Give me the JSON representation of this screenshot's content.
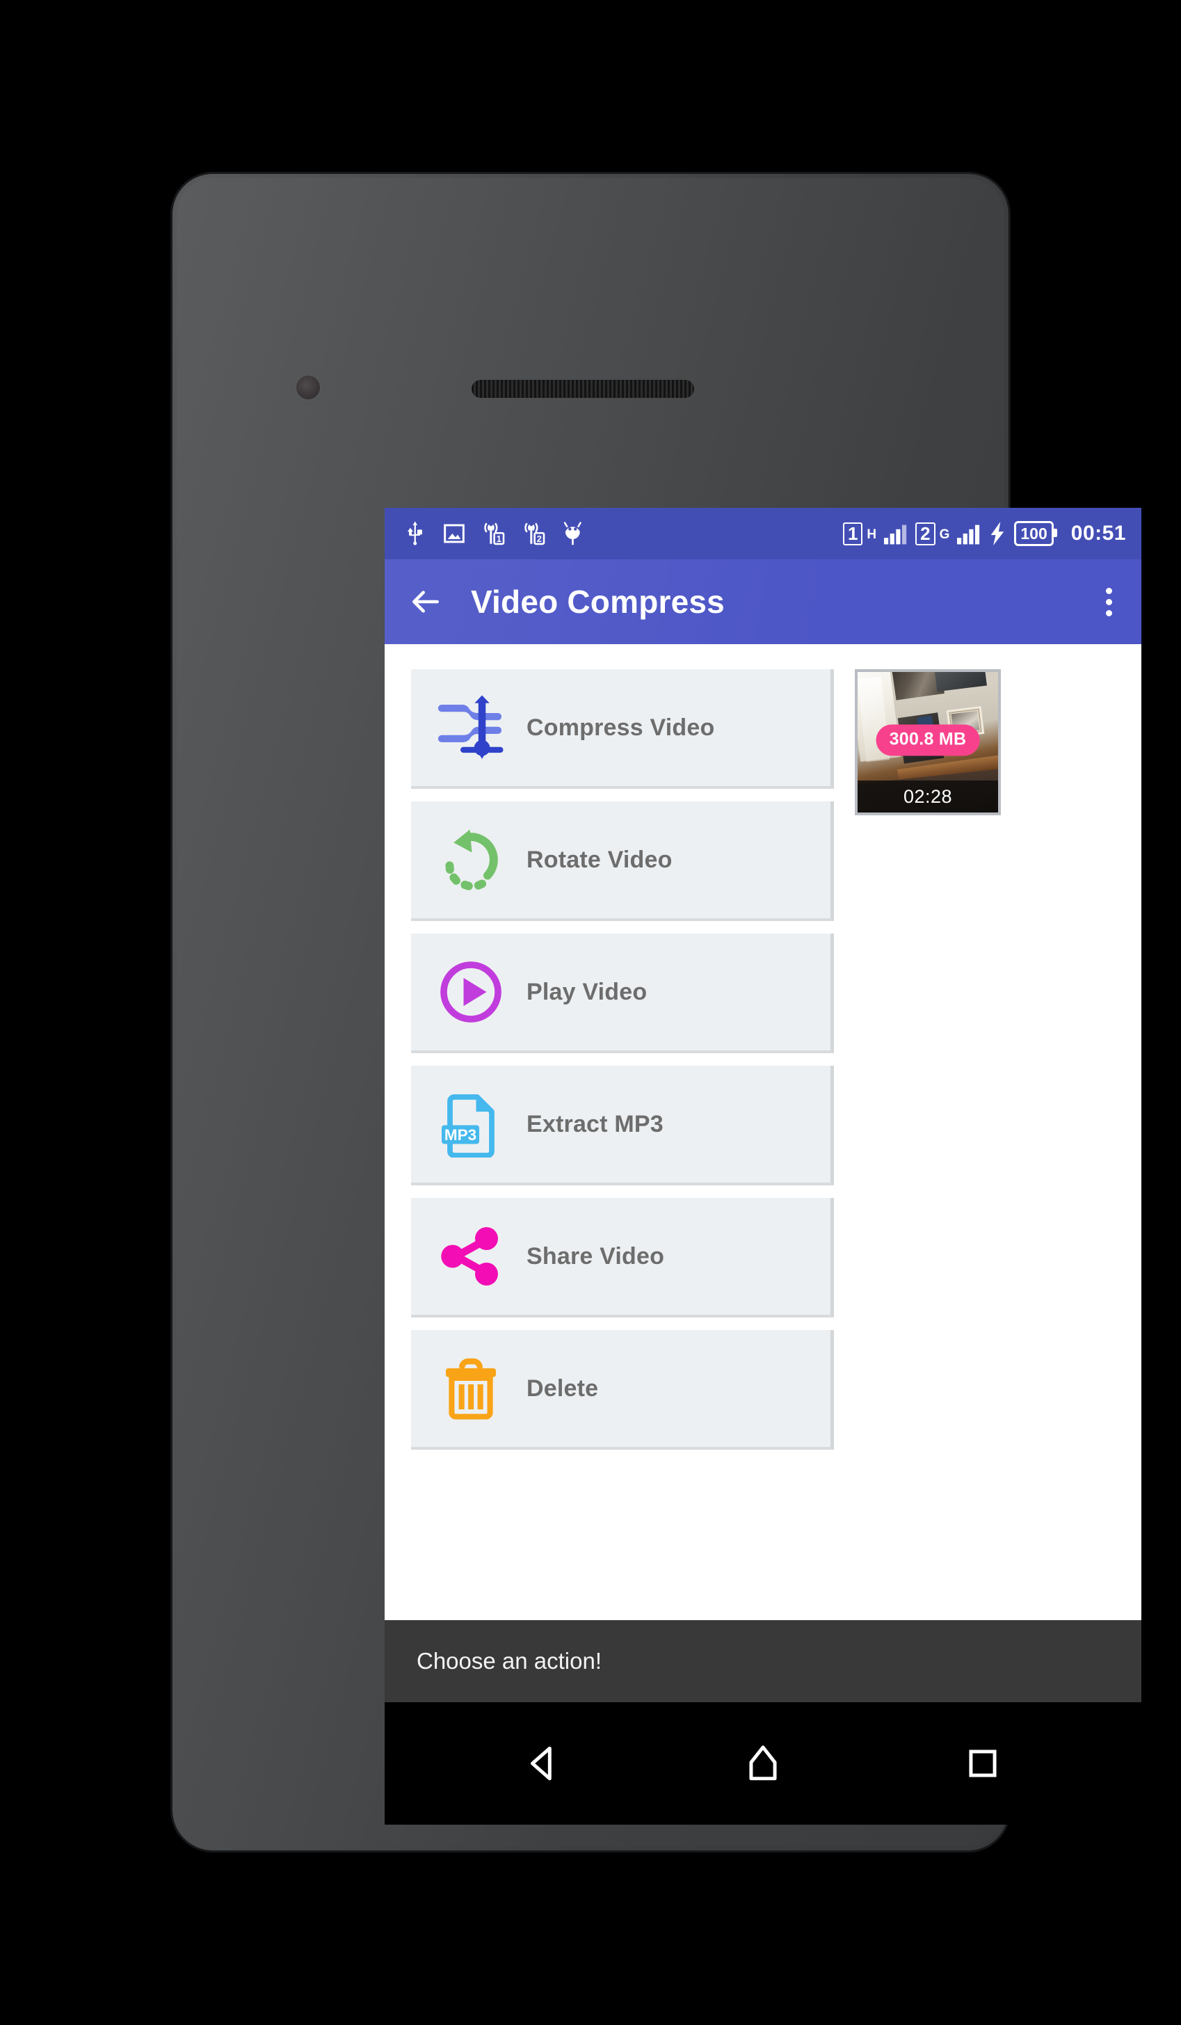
{
  "statusbar": {
    "left_icons": [
      "usb-icon",
      "image-icon",
      "signal-sim1-icon",
      "signal-sim2-icon",
      "android-debug-icon"
    ],
    "sim1_label": "1",
    "sim1_network": "H",
    "sim2_label": "2",
    "sim2_network": "G",
    "charging_icon": "bolt-icon",
    "battery_level": "100",
    "clock": "00:51",
    "background_color": "#434eb5"
  },
  "appbar": {
    "back_icon": "arrow-back-icon",
    "title": "Video Compress",
    "overflow_icon": "more-vert-icon",
    "background_color": "#4d56c6"
  },
  "actions": [
    {
      "label": "Compress Video",
      "icon": "compress-icon",
      "color": "#3b4cd0"
    },
    {
      "label": "Rotate Video",
      "icon": "rotate-icon",
      "color": "#74c16b"
    },
    {
      "label": "Play Video",
      "icon": "play-icon",
      "color": "#c13cdd"
    },
    {
      "label": "Extract MP3",
      "icon": "mp3-file-icon",
      "color": "#45b8ed"
    },
    {
      "label": "Share Video",
      "icon": "share-icon",
      "color": "#f20eb4"
    },
    {
      "label": "Delete",
      "icon": "trash-icon",
      "color": "#f9a317"
    }
  ],
  "video": {
    "size_badge": "300.8 MB",
    "duration": "02:28",
    "badge_color": "#f8418c",
    "thumbnail_alt": "room-interior-thumbnail"
  },
  "toast": {
    "message": "Choose an action!"
  },
  "navbar": {
    "back_icon": "nav-back-icon",
    "home_icon": "nav-home-icon",
    "recents_icon": "nav-recents-icon"
  }
}
